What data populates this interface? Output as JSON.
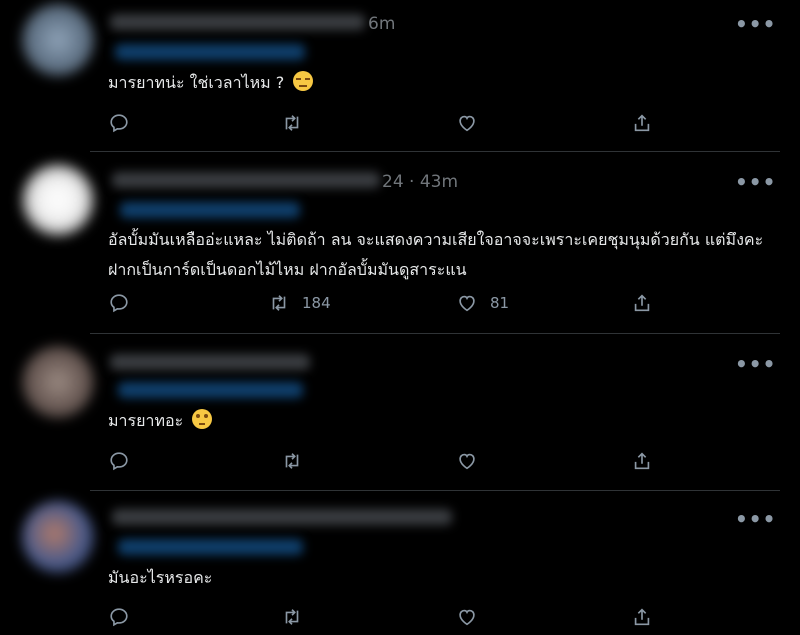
{
  "tweets": [
    {
      "time": "6m",
      "text": "มารยาทน่ะ ใช่เวลาไหม ?",
      "emoji": "unamused-face-icon",
      "reply_count": "",
      "retweet_count": "",
      "like_count": ""
    },
    {
      "time": "24 · 43m",
      "text": "อัลบั้มมันเหลืออ่ะแหละ ไม่ติดถ้า ลน จะแสดงความเสียใจอาจจะเพราะเคยชุมนุมด้วยกัน แต่มึงคะ ฝากเป็นการ์ดเป็นดอกไม้ไหม ฝากอัลบั้มมันดูสาระแน",
      "emoji": "",
      "reply_count": "",
      "retweet_count": "184",
      "like_count": "81"
    },
    {
      "time": "",
      "text": "มารยาทอะ",
      "emoji": "eye-roll-face-icon",
      "reply_count": "",
      "retweet_count": "",
      "like_count": ""
    },
    {
      "time": "",
      "text": "มันอะไรหรอคะ",
      "emoji": "",
      "reply_count": "",
      "retweet_count": "",
      "like_count": ""
    }
  ],
  "more_label": "•••",
  "colors": {
    "background": "#000000",
    "text": "#e7e9ea",
    "muted": "#71767b",
    "divider": "#2f3336",
    "emoji": "#f7c843"
  }
}
